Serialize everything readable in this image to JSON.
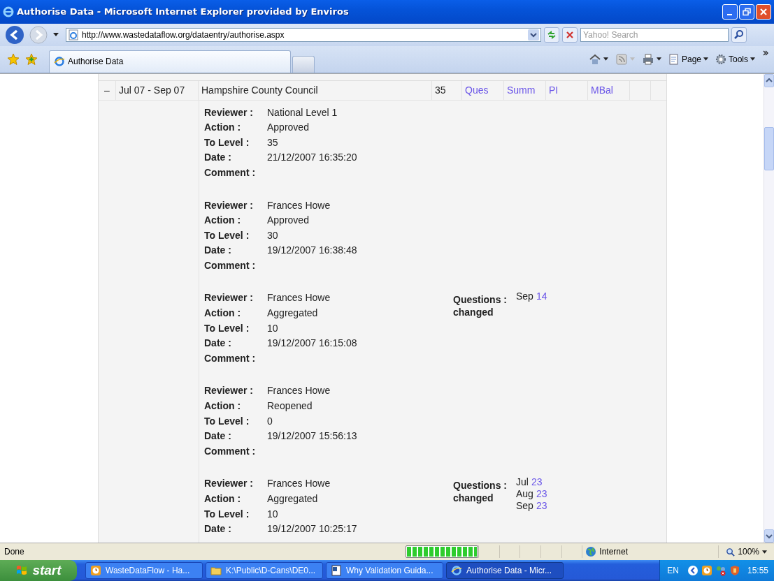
{
  "window": {
    "title": "Authorise Data - Microsoft Internet Explorer provided by Enviros"
  },
  "address_bar": {
    "url": "http://www.wastedataflow.org/dataentry/authorise.aspx",
    "search_placeholder": "Yahoo! Search"
  },
  "tabs": [
    {
      "label": "Authorise Data",
      "selected": true
    }
  ],
  "command_bar": [
    {
      "label": "Page",
      "kind": "page"
    },
    {
      "label": "Tools",
      "kind": "tools"
    }
  ],
  "summary_row": {
    "toggle": "–",
    "period": "Jul 07 - Sep 07",
    "authority": "Hampshire County Council",
    "level": "35",
    "links": [
      "Ques",
      "Summ",
      "PI",
      "MBal"
    ]
  },
  "history": [
    {
      "fields": [
        {
          "label": "Reviewer :",
          "value": "National Level 1"
        },
        {
          "label": "Action :",
          "value": "Approved"
        },
        {
          "label": "To Level :",
          "value": "35"
        },
        {
          "label": "Date :",
          "value": "21/12/2007 16:35:20"
        },
        {
          "label": "Comment :"
        }
      ]
    },
    {
      "fields": [
        {
          "label": "Reviewer :",
          "value": "Frances Howe"
        },
        {
          "label": "Action :",
          "value": "Approved"
        },
        {
          "label": "To Level :",
          "value": "30"
        },
        {
          "label": "Date :",
          "value": "19/12/2007 16:38:48"
        },
        {
          "label": "Comment :"
        }
      ]
    },
    {
      "fields": [
        {
          "label": "Reviewer :",
          "value": "Frances Howe"
        },
        {
          "label": "Action :",
          "value": "Aggregated"
        },
        {
          "label": "To Level :",
          "value": "10"
        },
        {
          "label": "Date :",
          "value": "19/12/2007 16:15:08"
        },
        {
          "label": "Comment :"
        }
      ],
      "questions": {
        "label": [
          "Questions :",
          "changed"
        ],
        "items": [
          {
            "month": "Sep",
            "count": "14"
          }
        ]
      }
    },
    {
      "fields": [
        {
          "label": "Reviewer :",
          "value": "Frances Howe"
        },
        {
          "label": "Action :",
          "value": "Reopened"
        },
        {
          "label": "To Level :",
          "value": "0"
        },
        {
          "label": "Date :",
          "value": "19/12/2007 15:56:13"
        },
        {
          "label": "Comment :"
        }
      ]
    },
    {
      "fields": [
        {
          "label": "Reviewer :",
          "value": "Frances Howe"
        },
        {
          "label": "Action :",
          "value": "Aggregated"
        },
        {
          "label": "To Level :",
          "value": "10"
        },
        {
          "label": "Date :",
          "value": "19/12/2007 10:25:17"
        }
      ],
      "questions": {
        "label": [
          "Questions :",
          "changed"
        ],
        "items": [
          {
            "month": "Jul",
            "count": "23"
          },
          {
            "month": "Aug",
            "count": "23"
          },
          {
            "month": "Sep",
            "count": "23"
          }
        ]
      }
    }
  ],
  "status_bar": {
    "text": "Done",
    "progress": {
      "level": 1
    },
    "zone": "Internet",
    "zoom": "100%"
  },
  "taskbar": {
    "start": "start",
    "tasks": [
      {
        "label": "WasteDataFlow - Ha...",
        "kind": "clock",
        "selected": false
      },
      {
        "label": "K:\\Public\\D-Cans\\DE0...",
        "kind": "folder",
        "selected": false
      },
      {
        "label": "Why Validation Guida...",
        "kind": "doc",
        "selected": false
      },
      {
        "label": "Authorise Data - Micr...",
        "kind": "ie",
        "selected": true
      }
    ],
    "language": "EN",
    "clock": "15:55"
  }
}
